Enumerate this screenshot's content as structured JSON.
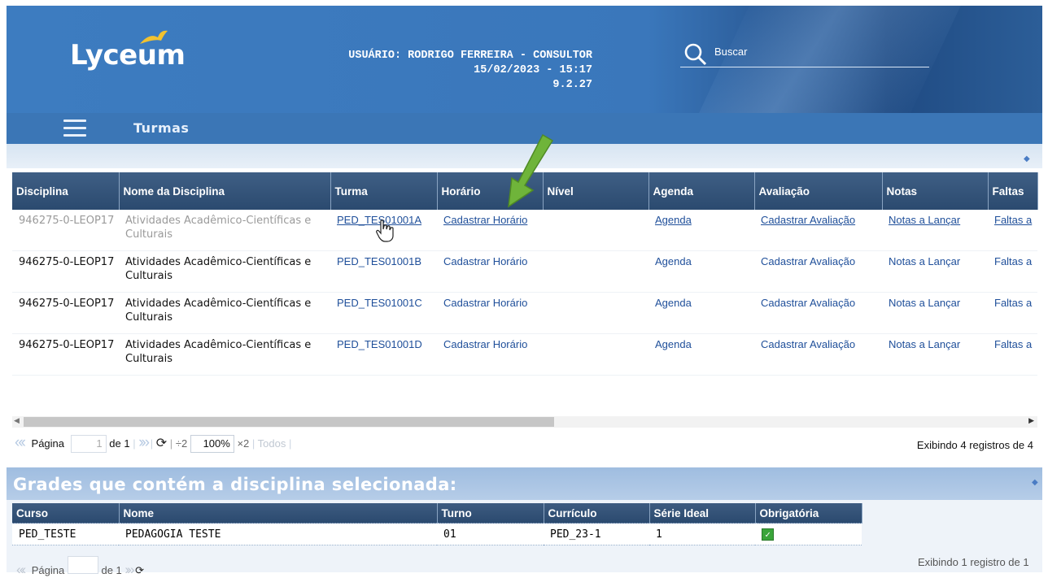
{
  "header": {
    "logo": "Lyceum",
    "user_line": "USUÁRIO: RODRIGO FERREIRA - CONSULTOR",
    "datetime": "15/02/2023 - 15:17",
    "version": "9.2.27",
    "search_label": "Buscar"
  },
  "nav": {
    "title": "Turmas"
  },
  "grid1": {
    "columns": [
      "Disciplina",
      "Nome da Disciplina",
      "Turma",
      "Horário",
      "Nível",
      "Agenda",
      "Avaliação",
      "Notas",
      "Faltas"
    ],
    "rows": [
      {
        "disciplina": "946275-0-LEOP17",
        "nome": "Atividades Acadêmico-Científicas e Culturais",
        "turma": "PED_TES01001A",
        "horario": "Cadastrar Horário",
        "nivel": "",
        "agenda": "Agenda",
        "avaliacao": "Cadastrar Avaliação",
        "notas": "Notas a Lançar",
        "faltas": "Faltas a"
      },
      {
        "disciplina": "946275-0-LEOP17",
        "nome": "Atividades Acadêmico-Científicas e Culturais",
        "turma": "PED_TES01001B",
        "horario": "Cadastrar Horário",
        "nivel": "",
        "agenda": "Agenda",
        "avaliacao": "Cadastrar Avaliação",
        "notas": "Notas a Lançar",
        "faltas": "Faltas a"
      },
      {
        "disciplina": "946275-0-LEOP17",
        "nome": "Atividades Acadêmico-Científicas e Culturais",
        "turma": "PED_TES01001C",
        "horario": "Cadastrar Horário",
        "nivel": "",
        "agenda": "Agenda",
        "avaliacao": "Cadastrar Avaliação",
        "notas": "Notas a Lançar",
        "faltas": "Faltas a"
      },
      {
        "disciplina": "946275-0-LEOP17",
        "nome": "Atividades Acadêmico-Científicas e Culturais",
        "turma": "PED_TES01001D",
        "horario": "Cadastrar Horário",
        "nivel": "",
        "agenda": "Agenda",
        "avaliacao": "Cadastrar Avaliação",
        "notas": "Notas a Lançar",
        "faltas": "Faltas a"
      }
    ],
    "pager": {
      "page_label": "Página",
      "page_value": "1",
      "of_label": "de 1",
      "divide_label": "÷2",
      "zoom_value": "100%",
      "times_label": "×2",
      "all_label": "Todos",
      "status": "Exibindo 4 registros de 4"
    }
  },
  "grid2": {
    "title": "Grades que contém a disciplina selecionada:",
    "columns": [
      "Curso",
      "Nome",
      "Turno",
      "Currículo",
      "Série Ideal",
      "Obrigatória"
    ],
    "rows": [
      {
        "curso": "PED_TESTE",
        "nome": "PEDAGOGIA TESTE",
        "turno": "01",
        "curriculo": "PED_23-1",
        "serie": "1",
        "obrigatoria": true
      }
    ],
    "pager": {
      "page_label": "Página",
      "of_label": "de 1",
      "status": "Exibindo 1 registro de 1"
    }
  },
  "icons": {
    "search": "search-icon",
    "menu": "hamburger-menu-icon",
    "refresh": "refresh-icon",
    "annotation": "green-arrow-icon"
  },
  "colors": {
    "header_blue": "#3d7cc0",
    "grid_header": "#2b4a6f",
    "link": "#1f4f9a",
    "annotation_green": "#6fb43a"
  }
}
